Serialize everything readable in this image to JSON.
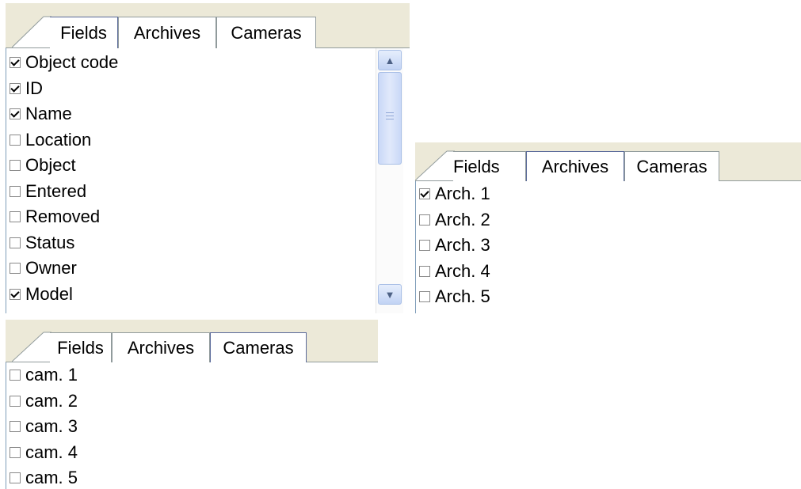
{
  "panel1": {
    "tabs": [
      {
        "label": "Fields",
        "active": true
      },
      {
        "label": "Archives",
        "active": false
      },
      {
        "label": "Cameras",
        "active": false
      }
    ],
    "items": [
      {
        "label": "Object code",
        "checked": true
      },
      {
        "label": "ID",
        "checked": true
      },
      {
        "label": "Name",
        "checked": true
      },
      {
        "label": "Location",
        "checked": false
      },
      {
        "label": "Object",
        "checked": false
      },
      {
        "label": "Entered",
        "checked": false
      },
      {
        "label": "Removed",
        "checked": false
      },
      {
        "label": "Status",
        "checked": false
      },
      {
        "label": "Owner",
        "checked": false
      },
      {
        "label": "Model",
        "checked": true
      }
    ],
    "scroll_up_icon": "chevron-up-icon",
    "scroll_down_icon": "chevron-down-icon"
  },
  "panel2": {
    "tabs": [
      {
        "label": "Fields",
        "active": false
      },
      {
        "label": "Archives",
        "active": true
      },
      {
        "label": "Cameras",
        "active": false
      }
    ],
    "items": [
      {
        "label": "Arch. 1",
        "checked": true
      },
      {
        "label": "Arch. 2",
        "checked": false
      },
      {
        "label": "Arch. 3",
        "checked": false
      },
      {
        "label": "Arch. 4",
        "checked": false
      },
      {
        "label": "Arch. 5",
        "checked": false
      }
    ]
  },
  "panel3": {
    "tabs": [
      {
        "label": "Fields",
        "active": false
      },
      {
        "label": "Archives",
        "active": false
      },
      {
        "label": "Cameras",
        "active": true
      }
    ],
    "items": [
      {
        "label": "cam. 1",
        "checked": false
      },
      {
        "label": "cam. 2",
        "checked": false
      },
      {
        "label": "cam. 3",
        "checked": false
      },
      {
        "label": "cam. 4",
        "checked": false
      },
      {
        "label": "cam. 5",
        "checked": false
      }
    ]
  }
}
